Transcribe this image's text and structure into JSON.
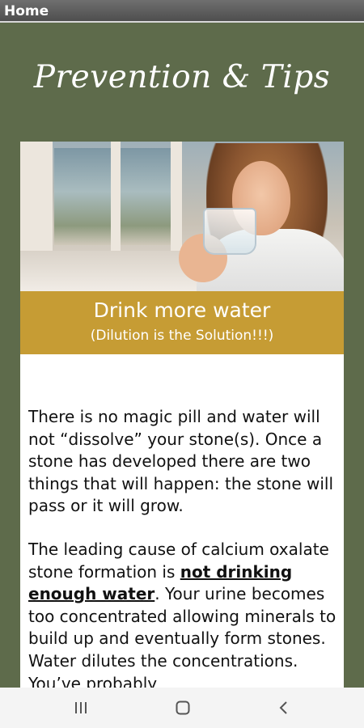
{
  "header": {
    "home_label": "Home"
  },
  "page": {
    "title": "Prevention & Tips"
  },
  "card": {
    "heading": "Drink more water",
    "subheading": "(Dilution is the Solution!!!)",
    "paragraph1": "There is no magic pill and water will not “dissolve” your stone(s). Once a stone has developed there are two things that will happen: the stone will pass or it will grow.",
    "paragraph2_part1": "The leading cause of calcium oxalate stone formation is ",
    "paragraph2_emphasis": "not drinking enough water",
    "paragraph2_part2": ". Your urine becomes too concentrated allowing minerals to build up and eventually form stones. Water dilutes the concentrations. You’ve probably"
  },
  "navbar": {
    "icons": [
      "recent-apps-icon",
      "home-icon",
      "back-icon"
    ]
  },
  "colors": {
    "background": "#5e6b4b",
    "banner": "#c69c34",
    "topbar": "#5a5a5a",
    "text": "#111111"
  }
}
